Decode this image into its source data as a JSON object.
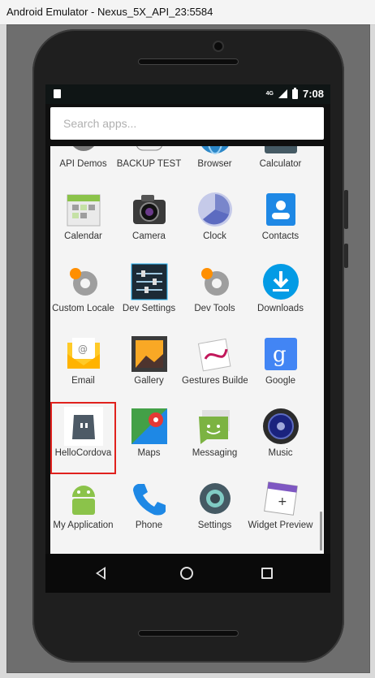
{
  "window": {
    "title": "Android Emulator - Nexus_5X_API_23:5584"
  },
  "statusbar": {
    "network": "4G",
    "time": "7:08"
  },
  "search": {
    "placeholder": "Search apps..."
  },
  "apps": [
    {
      "label": "API Demos",
      "icon": "gear-icon"
    },
    {
      "label": "BACKUP TEST",
      "icon": "android-head-icon"
    },
    {
      "label": "Browser",
      "icon": "globe-icon"
    },
    {
      "label": "Calculator",
      "icon": "calculator-icon"
    },
    {
      "label": "Calendar",
      "icon": "calendar-icon"
    },
    {
      "label": "Camera",
      "icon": "camera-icon"
    },
    {
      "label": "Clock",
      "icon": "clock-icon"
    },
    {
      "label": "Contacts",
      "icon": "contacts-icon"
    },
    {
      "label": "Custom Locale",
      "icon": "gear-icon"
    },
    {
      "label": "Dev Settings",
      "icon": "sliders-icon"
    },
    {
      "label": "Dev Tools",
      "icon": "gear-icon"
    },
    {
      "label": "Downloads",
      "icon": "download-icon"
    },
    {
      "label": "Email",
      "icon": "email-icon"
    },
    {
      "label": "Gallery",
      "icon": "gallery-icon"
    },
    {
      "label": "Gestures Builder",
      "icon": "gestures-icon"
    },
    {
      "label": "Google",
      "icon": "google-icon"
    },
    {
      "label": "HelloCordova",
      "icon": "cordova-icon",
      "highlighted": true
    },
    {
      "label": "Maps",
      "icon": "maps-icon"
    },
    {
      "label": "Messaging",
      "icon": "messaging-icon"
    },
    {
      "label": "Music",
      "icon": "speaker-icon"
    },
    {
      "label": "My Application",
      "icon": "android-icon"
    },
    {
      "label": "Phone",
      "icon": "phone-icon"
    },
    {
      "label": "Settings",
      "icon": "settings-icon"
    },
    {
      "label": "Widget Preview",
      "icon": "widget-preview-icon"
    }
  ],
  "colors": {
    "highlight": "#e0211d",
    "drawer_bg": "#f4f4f4"
  }
}
